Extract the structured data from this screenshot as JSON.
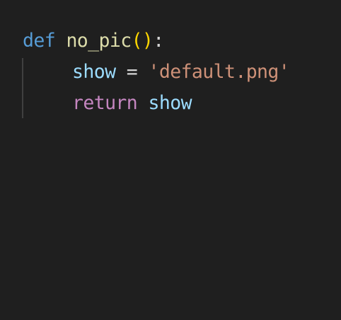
{
  "code": {
    "line1": {
      "keyword": "def",
      "space": " ",
      "function_name": "no_pic",
      "parens": "()",
      "colon": ":"
    },
    "line2": {
      "variable": "show",
      "operator": " = ",
      "string": "'default.png'"
    },
    "line3": {
      "keyword": "return",
      "space": " ",
      "variable": "show"
    }
  },
  "colors": {
    "background": "#1f1f1f",
    "keyword_def": "#569cd6",
    "function_name": "#dcdcaa",
    "parens": "#ffd700",
    "variable": "#9cdcfe",
    "string": "#ce9178",
    "keyword_return": "#c586c0",
    "indent_guide": "#404040"
  }
}
